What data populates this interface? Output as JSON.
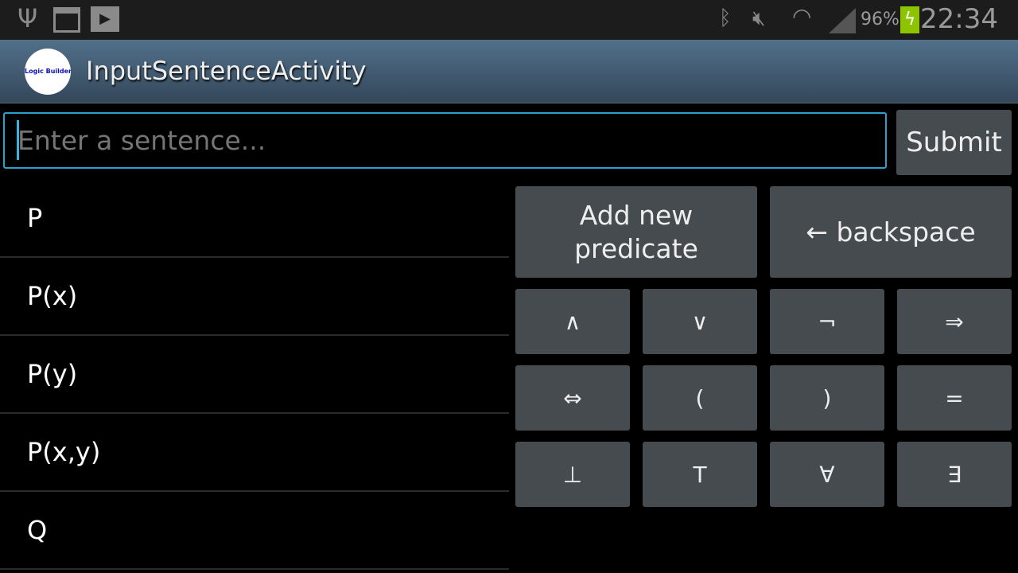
{
  "status_bar": {
    "icons": [
      "usb-icon",
      "calendar-icon",
      "play-store-icon",
      "bluetooth-icon",
      "mute-icon",
      "wifi-icon",
      "signal-icon",
      "battery-charging-icon"
    ],
    "battery": "96%",
    "time": "22:34",
    "battery_color": "#8cc400"
  },
  "action_bar": {
    "logo_text": "Logic Builder",
    "title": "InputSentenceActivity"
  },
  "input": {
    "placeholder": "Enter a sentence...",
    "value": ""
  },
  "submit_label": "Submit",
  "predicates": [
    "P",
    "P(x)",
    "P(y)",
    "P(x,y)",
    "Q"
  ],
  "keys": {
    "add_predicate": "Add new predicate",
    "backspace": "← backspace",
    "symbols": [
      "∧",
      "∨",
      "¬",
      "⇒",
      "⇔",
      "(",
      ")",
      "=",
      "⊥",
      "T",
      "∀",
      "∃"
    ]
  },
  "accent": "#2a9fd0"
}
